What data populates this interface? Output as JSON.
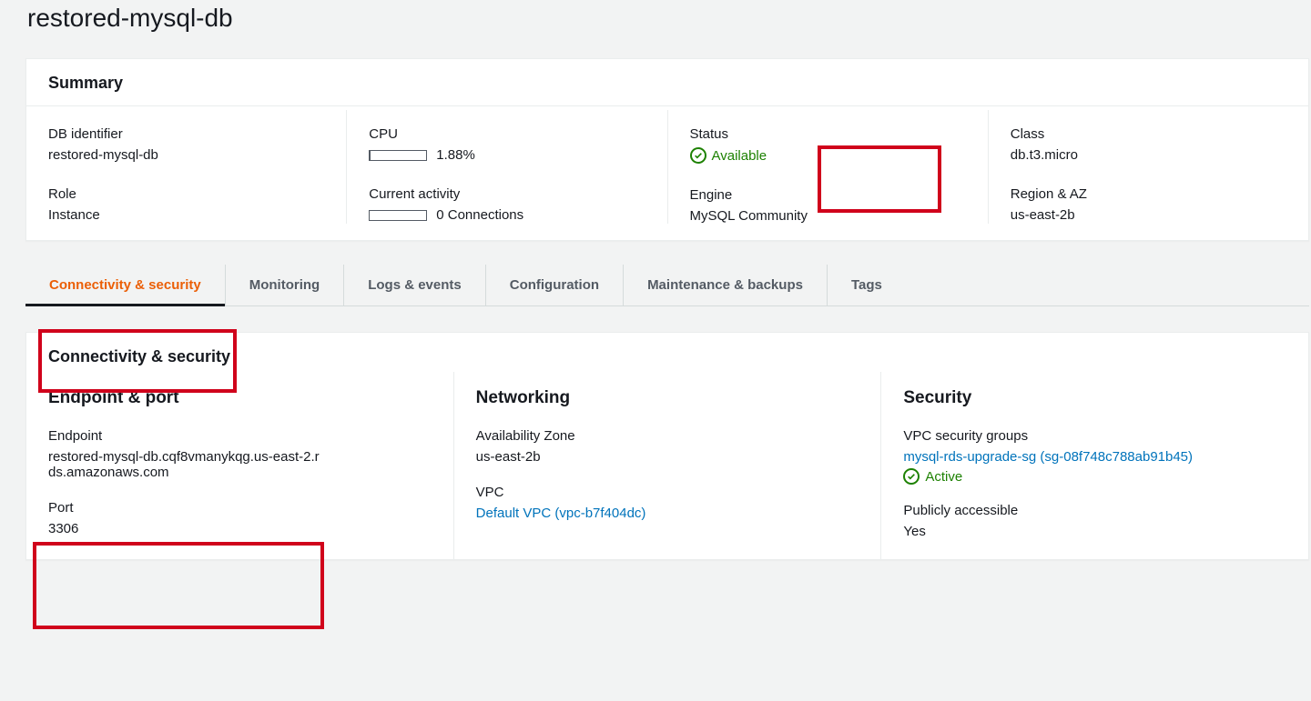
{
  "page_title": "restored-mysql-db",
  "summary": {
    "header": "Summary",
    "col1": {
      "db_identifier_label": "DB identifier",
      "db_identifier_value": "restored-mysql-db",
      "role_label": "Role",
      "role_value": "Instance"
    },
    "col2": {
      "cpu_label": "CPU",
      "cpu_value": "1.88%",
      "activity_label": "Current activity",
      "activity_value": "0 Connections"
    },
    "col3": {
      "status_label": "Status",
      "status_value": "Available",
      "engine_label": "Engine",
      "engine_value": "MySQL Community"
    },
    "col4": {
      "class_label": "Class",
      "class_value": "db.t3.micro",
      "region_label": "Region & AZ",
      "region_value": "us-east-2b"
    }
  },
  "tabs": {
    "connectivity": "Connectivity & security",
    "monitoring": "Monitoring",
    "logs": "Logs & events",
    "configuration": "Configuration",
    "maintenance": "Maintenance & backups",
    "tags": "Tags"
  },
  "connectivity": {
    "header": "Connectivity & security",
    "endpoint_port_header": "Endpoint & port",
    "endpoint_label": "Endpoint",
    "endpoint_value": "restored-mysql-db.cqf8vmanykqg.us-east-2.rds.amazonaws.com",
    "port_label": "Port",
    "port_value": "3306",
    "networking_header": "Networking",
    "az_label": "Availability Zone",
    "az_value": "us-east-2b",
    "vpc_label": "VPC",
    "vpc_value": "Default VPC (vpc-b7f404dc)",
    "security_header": "Security",
    "sg_label": "VPC security groups",
    "sg_value": "mysql-rds-upgrade-sg (sg-08f748c788ab91b45)",
    "sg_status": "Active",
    "public_label": "Publicly accessible",
    "public_value": "Yes"
  }
}
